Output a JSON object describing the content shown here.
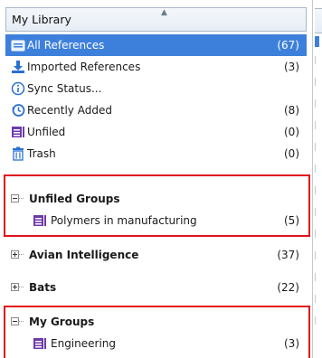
{
  "header": {
    "title": "My Library"
  },
  "library": [
    {
      "label": "All References",
      "count": "(67)",
      "icon": "all-references-icon",
      "selected": true
    },
    {
      "label": "Imported References",
      "count": "(3)",
      "icon": "import-icon"
    },
    {
      "label": "Sync Status...",
      "count": "",
      "icon": "info-icon"
    },
    {
      "label": "Recently Added",
      "count": "(8)",
      "icon": "history-clock-icon"
    },
    {
      "label": "Unfiled",
      "count": "(0)",
      "icon": "unfiled-icon"
    },
    {
      "label": "Trash",
      "count": "(0)",
      "icon": "trash-icon"
    }
  ],
  "groups": {
    "unfiled_groups": {
      "label": "Unfiled Groups",
      "child_label": "Polymers in manufacturing",
      "child_count": "(5)"
    },
    "avian": {
      "label": "Avian Intelligence",
      "count": "(37)"
    },
    "bats": {
      "label": "Bats",
      "count": "(22)"
    },
    "my_groups": {
      "label": "My Groups",
      "child_label": "Engineering",
      "child_count": "(3)"
    }
  },
  "colors": {
    "selection": "#3d80dc",
    "highlight_box": "#e0141e",
    "group_icon": "#6e3aa8"
  }
}
